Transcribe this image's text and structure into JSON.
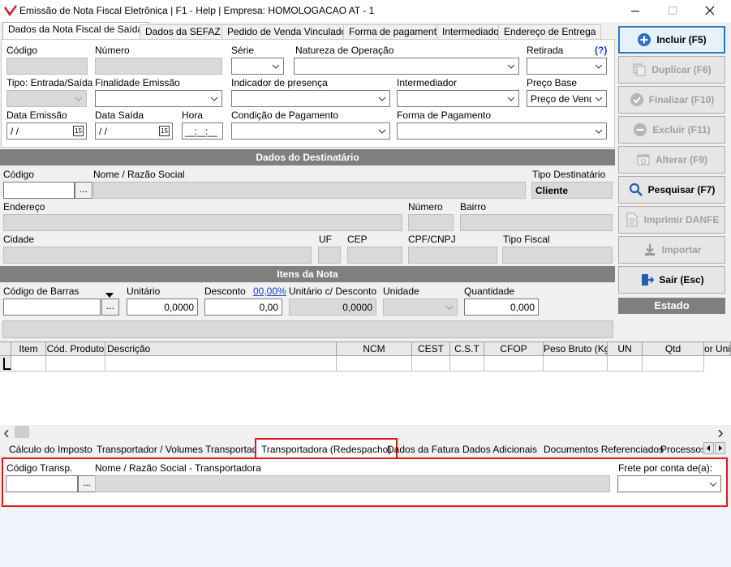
{
  "window": {
    "title": "Emissão de Nota Fiscal Eletrônica | F1 - Help | Empresa: HOMOLOGACAO AT - 1"
  },
  "top_tabs": [
    "Dados da Nota Fiscal de Saída",
    "Dados da SEFAZ",
    "Pedido de Venda Vinculado",
    "Forma de pagamento",
    "Intermediador",
    "Endereço de Entrega"
  ],
  "nota": {
    "codigo_label": "Código",
    "numero_label": "Número",
    "serie_label": "Série",
    "natureza_label": "Natureza de Operação",
    "retirada_label": "Retirada",
    "help_link": "(?)",
    "tipo_label": "Tipo: Entrada/Saída",
    "finalidade_label": "Finalidade Emissão",
    "indicador_label": "Indicador de presença",
    "intermediador_label": "Intermediador",
    "preco_base_label": "Preço Base",
    "preco_base_value": "Preço de Venda",
    "data_emissao_label": "Data Emissão",
    "data_emissao_value": " /  /",
    "data_saida_label": "Data Saída",
    "data_saida_value": " /  /",
    "hora_label": "Hora",
    "hora_value": "__:__:__",
    "condicao_label": "Condição de Pagamento",
    "forma_label": "Forma de Pagamento"
  },
  "destinatario": {
    "section_title": "Dados  do Destinatário",
    "codigo_label": "Código",
    "nome_label": "Nome / Razão Social",
    "tipo_dest_label": "Tipo Destinatário",
    "tipo_dest_value": "Cliente",
    "endereco_label": "Endereço",
    "numero_label": "Número",
    "bairro_label": "Bairro",
    "cidade_label": "Cidade",
    "uf_label": "UF",
    "cep_label": "CEP",
    "cpf_label": "CPF/CNPJ",
    "tipo_fiscal_label": "Tipo Fiscal"
  },
  "itens": {
    "section_title": "Itens da Nota",
    "barras_label": "Código de Barras",
    "unitario_label": "Unitário",
    "unitario_value": "0,0000",
    "desconto_label": "Desconto",
    "desconto_pct": "00,00%",
    "desconto_value": "0,00",
    "unit_desc_label": "Unitário c/ Desconto",
    "unit_desc_value": "0,0000",
    "unidade_label": "Unidade",
    "quantidade_label": "Quantidade",
    "quantidade_value": "0,000"
  },
  "grid": {
    "columns": [
      "Item",
      "Cód. Produto",
      "Descrição",
      "NCM",
      "CEST",
      "C.S.T",
      "CFOP",
      "Peso Bruto (Kg)",
      "UN",
      "Qtd",
      "or Uni"
    ]
  },
  "bottom_tabs": [
    "Cálculo do Imposto",
    "Transportador / Volumes Transportados",
    "Transportadora (Redespacho)",
    "Dados da Fatura",
    "Dados Adicionais",
    "Documentos Referenciados",
    "Processos"
  ],
  "redespacho": {
    "codigo_label": "Código Transp.",
    "nome_label": "Nome / Razão Social - Transportadora",
    "frete_label": "Frete por conta de(a):"
  },
  "actions": {
    "incluir": "Incluir (F5)",
    "duplicar": "Duplicar (F6)",
    "finalizar": "Finalizar (F10)",
    "excluir": "Excluir (F11)",
    "alterar": "Alterar (F9)",
    "pesquisar": "Pesquisar (F7)",
    "imprimir": "Imprimir DANFE",
    "importar": "Importar",
    "sair": "Sair (Esc)",
    "estado_title": "Estado"
  },
  "colors": {
    "highlight": "#e3161d",
    "section_bg": "#7f7f7f",
    "accent_blue": "#2a78d0"
  }
}
